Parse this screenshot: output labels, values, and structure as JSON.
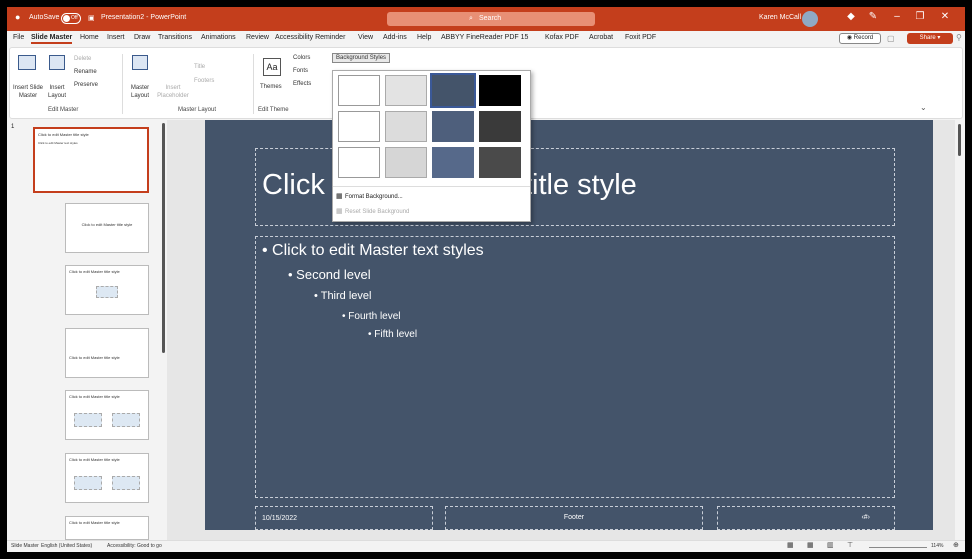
{
  "titlebar": {
    "autosave_label": "AutoSave",
    "autosave_state": "Off",
    "doc_title": "Presentation2 - PowerPoint",
    "search_placeholder": "Search",
    "user_name": "Karen McCall"
  },
  "menu": [
    "File",
    "Slide Master",
    "Home",
    "Insert",
    "Draw",
    "Transitions",
    "Animations",
    "Review",
    "Accessibility Reminder",
    "View",
    "Add-ins",
    "Help",
    "ABBYY FineReader PDF 15",
    "Kofax PDF",
    "Acrobat",
    "Foxit PDF"
  ],
  "menu_active": "Slide Master",
  "record_label": "Record",
  "share_label": "Share",
  "ribbon": {
    "insert_slide_master": "Insert Slide Master",
    "insert_layout": "Insert Layout",
    "delete": "Delete",
    "rename": "Rename",
    "preserve": "Preserve",
    "group_edit_master": "Edit Master",
    "master_layout": "Master Layout",
    "insert_placeholder": "Insert Placeholder",
    "title": "Title",
    "footers": "Footers",
    "group_master_layout": "Master Layout",
    "themes": "Themes",
    "group_edit_theme": "Edit Theme",
    "colors": "Colors",
    "fonts": "Fonts",
    "effects": "Effects",
    "background_styles": "Background Styles"
  },
  "dropdown": {
    "format_background": "Format Background...",
    "reset_background": "Reset Slide Background",
    "swatches": [
      [
        "#ffffff",
        "#e3e3e3",
        "#44546a",
        "#000000"
      ],
      [
        "#ffffff",
        "#dcdcdc",
        "#4e5f7c",
        "#3a3a3a"
      ],
      [
        "#ffffff",
        "#d6d6d6",
        "#56698a",
        "#4a4a4a"
      ]
    ],
    "selected": [
      0,
      2
    ]
  },
  "thumbnails": {
    "slide_number": "1",
    "master_title": "Click to edit Master title style",
    "master_text": "Click to edit Master text styles"
  },
  "slide": {
    "title_left": "Click t",
    "title_right": "title style",
    "levels": [
      "Click to edit Master text styles",
      "Second level",
      "Third level",
      "Fourth level",
      "Fifth level"
    ],
    "date": "10/15/2022",
    "footer": "Footer",
    "page_num": "‹#›",
    "background": "#44546a"
  },
  "status": {
    "view": "Slide Master",
    "language": "English (United States)",
    "accessibility": "Accessibility: Good to go",
    "zoom": "114%"
  }
}
